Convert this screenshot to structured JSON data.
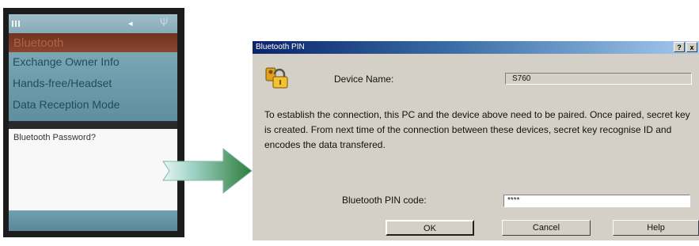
{
  "phone": {
    "title": "Bluetooth",
    "menu_items": [
      "Exchange Owner Info",
      "Hands-free/Headset",
      "Data Reception Mode"
    ],
    "password_label": "Bluetooth Password?",
    "status_center_icon": "speaker-icon",
    "status_right_icon": "antenna-icon"
  },
  "dialog": {
    "title": "Bluetooth PIN",
    "help_glyph": "?",
    "close_glyph": "x",
    "device_name_label": "Device Name:",
    "device_name_value": "S760",
    "description": "To establish the connection, this PC and the device above need to be paired. Once paired, secret key is created. From next time of the connection between these devices, secret key recognise ID and encodes the data transfered.",
    "pin_label": "Bluetooth PIN code:",
    "pin_value": "****",
    "buttons": {
      "ok": "OK",
      "cancel": "Cancel",
      "help": "Help"
    }
  },
  "colors": {
    "phone_menu": "#6f9aab",
    "phone_title": "#7a3c28",
    "dialog_bg": "#d4d0c8",
    "titlebar": "#0a246a",
    "arrow_green": "#2e7d3a"
  }
}
